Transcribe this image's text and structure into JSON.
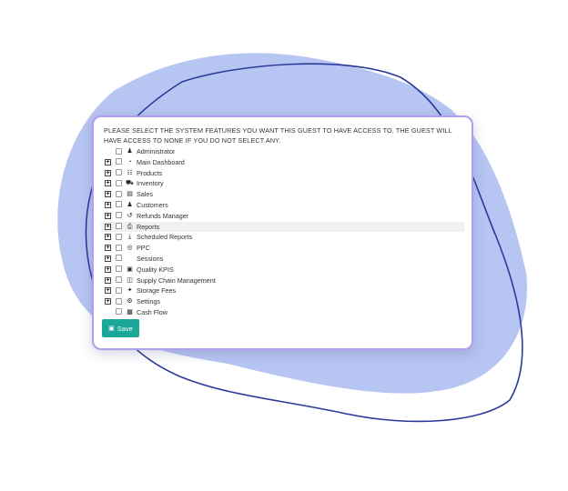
{
  "instructions": "PLEASE SELECT THE SYSTEM FEATURES YOU WANT THIS GUEST TO HAVE ACCESS TO. THE GUEST WILL HAVE ACCESS TO NONE IF YOU DO NOT SELECT ANY.",
  "features": [
    {
      "label": "Administrator",
      "icon": "user-icon",
      "expandable": false,
      "checked": false
    },
    {
      "label": "Main Dashboard",
      "icon": "dashboard-gauge-icon",
      "expandable": true,
      "checked": false
    },
    {
      "label": "Products",
      "icon": "barcode-icon",
      "expandable": true,
      "checked": false
    },
    {
      "label": "Inventory",
      "icon": "truck-icon",
      "expandable": true,
      "checked": false
    },
    {
      "label": "Sales",
      "icon": "money-icon",
      "expandable": true,
      "checked": false
    },
    {
      "label": "Customers",
      "icon": "users-icon",
      "expandable": true,
      "checked": false
    },
    {
      "label": "Refunds Manager",
      "icon": "undo-icon",
      "expandable": true,
      "checked": false
    },
    {
      "label": "Reports",
      "icon": "print-icon",
      "expandable": true,
      "checked": false,
      "highlighted": true
    },
    {
      "label": "Scheduled Reports",
      "icon": "download-icon",
      "expandable": true,
      "checked": false
    },
    {
      "label": "PPC",
      "icon": "target-icon",
      "expandable": true,
      "checked": false
    },
    {
      "label": "Sessions",
      "icon": "",
      "expandable": true,
      "checked": false
    },
    {
      "label": "Quality KPIS",
      "icon": "briefcase-icon",
      "expandable": true,
      "checked": false
    },
    {
      "label": "Supply Chain Management",
      "icon": "dolly-icon",
      "expandable": true,
      "checked": false
    },
    {
      "label": "Storage Fees",
      "icon": "tag-icon",
      "expandable": true,
      "checked": false
    },
    {
      "label": "Settings",
      "icon": "gear-icon",
      "expandable": true,
      "checked": false
    },
    {
      "label": "Cash Flow",
      "icon": "cash-icon",
      "expandable": false,
      "checked": false
    }
  ],
  "save_label": "Save",
  "colors": {
    "accent": "#1ba79a",
    "card_border": "#b49cf0",
    "blob_fill": "#b7c5f3",
    "blob_stroke": "#2a3a9a"
  }
}
